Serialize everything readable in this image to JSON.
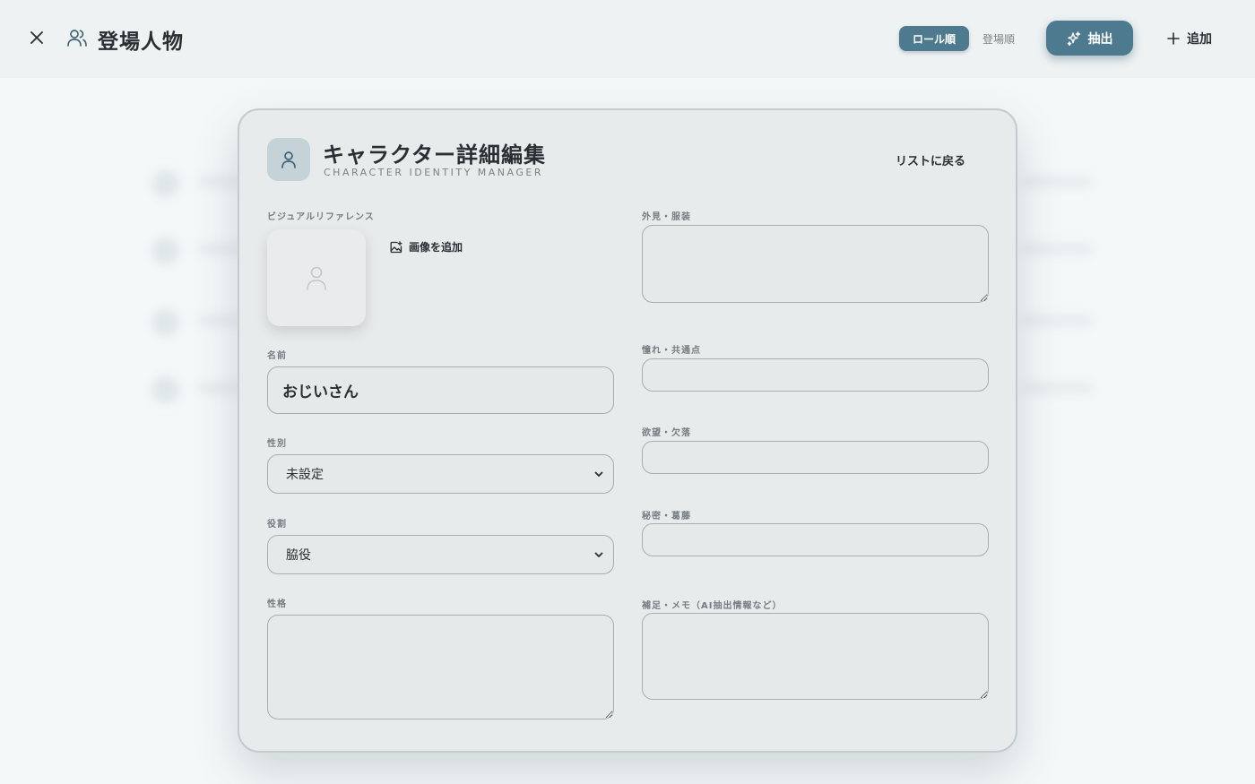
{
  "header": {
    "title": "登場人物",
    "sort_options": [
      {
        "label": "ロール順",
        "active": true
      },
      {
        "label": "登場順",
        "active": false
      }
    ],
    "extract_label": "抽出",
    "add_label": "追加"
  },
  "modal": {
    "title": "キャラクター詳細編集",
    "subtitle": "CHARACTER IDENTITY MANAGER",
    "back_label": "リストに戻る",
    "visual_ref_label": "ビジュアルリファレンス",
    "add_image_label": "画像を追加",
    "name": {
      "label": "名前",
      "value": "おじいさん"
    },
    "gender": {
      "label": "性別",
      "value": "未設定"
    },
    "role": {
      "label": "役割",
      "value": "脇役"
    },
    "personality": {
      "label": "性格",
      "value": ""
    },
    "appearance": {
      "label": "外見・服装",
      "value": ""
    },
    "aspiration": {
      "label": "憧れ・共通点",
      "value": ""
    },
    "desire": {
      "label": "欲望・欠落",
      "value": ""
    },
    "secret": {
      "label": "秘密・葛藤",
      "value": ""
    },
    "notes": {
      "label": "補足・メモ（AI抽出情報など）",
      "value": ""
    }
  },
  "colors": {
    "accent": "#4d7a8e",
    "modal_bg": "#e8ebec",
    "header_bg": "#eef2f3"
  }
}
